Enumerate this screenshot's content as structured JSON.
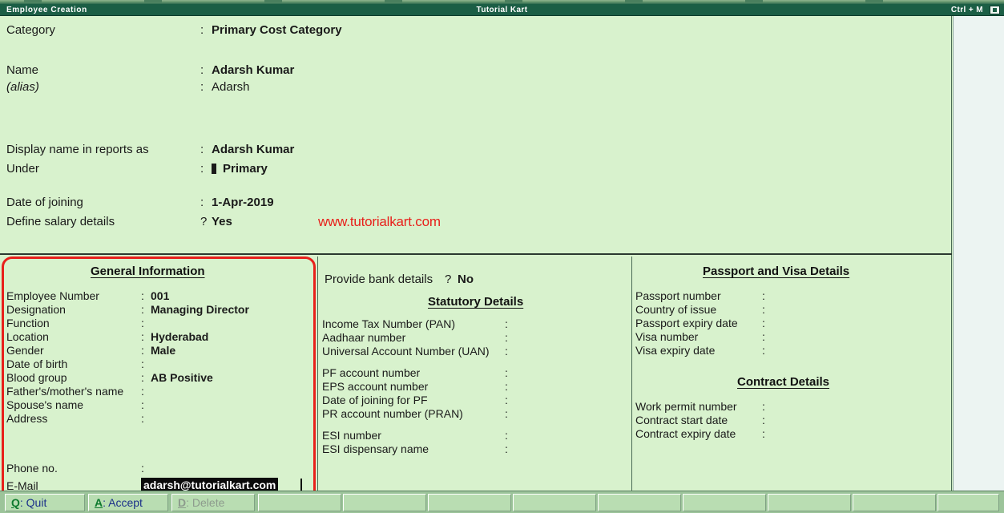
{
  "window": {
    "title_left": "Employee  Creation",
    "title_center": "Tutorial Kart",
    "title_right": "Ctrl + M",
    "minimize_icon": "restore-icon"
  },
  "form": {
    "rows": [
      {
        "label": "Category",
        "sep": ":",
        "value": "Primary Cost Category",
        "bold": true
      },
      {
        "label": "Name",
        "sep": ":",
        "value": "Adarsh Kumar",
        "bold": true
      },
      {
        "label": "(alias)",
        "sep": ":",
        "value": "Adarsh",
        "bold": false
      },
      {
        "label": "Display name in reports as",
        "sep": ":",
        "value": "Adarsh Kumar",
        "bold": true
      },
      {
        "label": "Under",
        "sep": ":",
        "value": "Primary",
        "bold": true,
        "marker": true
      },
      {
        "label": "Date of joining",
        "sep": ":",
        "value": "1-Apr-2019",
        "bold": true
      },
      {
        "label": "Define salary details",
        "sep": "?",
        "value": "Yes",
        "bold": true
      }
    ],
    "watermark": "www.tutorialkart.com",
    "watermark_color": "#e8201b"
  },
  "general_information": {
    "title": "General Information",
    "fields": [
      {
        "label": "Employee Number",
        "value": "001"
      },
      {
        "label": "Designation",
        "value": "Managing Director"
      },
      {
        "label": "Function",
        "value": ""
      },
      {
        "label": "Location",
        "value": "Hyderabad"
      },
      {
        "label": "Gender",
        "value": "Male"
      },
      {
        "label": "Date of birth",
        "value": ""
      },
      {
        "label": "Blood group",
        "value": "AB Positive"
      },
      {
        "label": "Father's/mother's name",
        "value": ""
      },
      {
        "label": "Spouse's name",
        "value": ""
      },
      {
        "label": "Address",
        "value": ""
      },
      {
        "label": "Phone no.",
        "value": ""
      },
      {
        "label": "E-Mail",
        "value": "adarsh@tutorialkart.com"
      }
    ],
    "email_value": "adarsh@tutorialkart.com"
  },
  "bank": {
    "label": "Provide bank details",
    "sep": "?",
    "value": "No"
  },
  "statutory_details": {
    "title": "Statutory Details",
    "fields": [
      {
        "label": "Income Tax Number (PAN)",
        "value": ""
      },
      {
        "label": "Aadhaar number",
        "value": ""
      },
      {
        "label": "Universal Account Number (UAN)",
        "value": ""
      },
      {
        "label": "PF account number",
        "value": ""
      },
      {
        "label": "EPS account number",
        "value": ""
      },
      {
        "label": "Date of joining for PF",
        "value": ""
      },
      {
        "label": "PR account number (PRAN)",
        "value": ""
      },
      {
        "label": "ESI number",
        "value": ""
      },
      {
        "label": "ESI dispensary name",
        "value": ""
      }
    ]
  },
  "passport_visa": {
    "title": "Passport and Visa Details",
    "fields": [
      {
        "label": "Passport number",
        "value": ""
      },
      {
        "label": "Country of issue",
        "value": ""
      },
      {
        "label": "Passport expiry date",
        "value": ""
      },
      {
        "label": "Visa number",
        "value": ""
      },
      {
        "label": "Visa expiry date",
        "value": ""
      }
    ]
  },
  "contract": {
    "title": "Contract Details",
    "fields": [
      {
        "label": "Work permit number",
        "value": ""
      },
      {
        "label": "Contract start date",
        "value": ""
      },
      {
        "label": "Contract expiry date",
        "value": ""
      }
    ]
  },
  "buttonbar": {
    "buttons": [
      {
        "key": "Q",
        "label": ": Quit",
        "enabled": true
      },
      {
        "key": "A",
        "label": ": Accept",
        "enabled": true
      },
      {
        "key": "D",
        "label": ": Delete",
        "enabled": false
      },
      {
        "key": "",
        "label": "",
        "enabled": true
      },
      {
        "key": "",
        "label": "",
        "enabled": true
      },
      {
        "key": "",
        "label": "",
        "enabled": true
      },
      {
        "key": "",
        "label": "",
        "enabled": true
      },
      {
        "key": "",
        "label": "",
        "enabled": true
      },
      {
        "key": "",
        "label": "",
        "enabled": true
      },
      {
        "key": "",
        "label": "",
        "enabled": true
      },
      {
        "key": "",
        "label": "",
        "enabled": true
      },
      {
        "key": "",
        "label": "",
        "enabled": true
      }
    ]
  }
}
